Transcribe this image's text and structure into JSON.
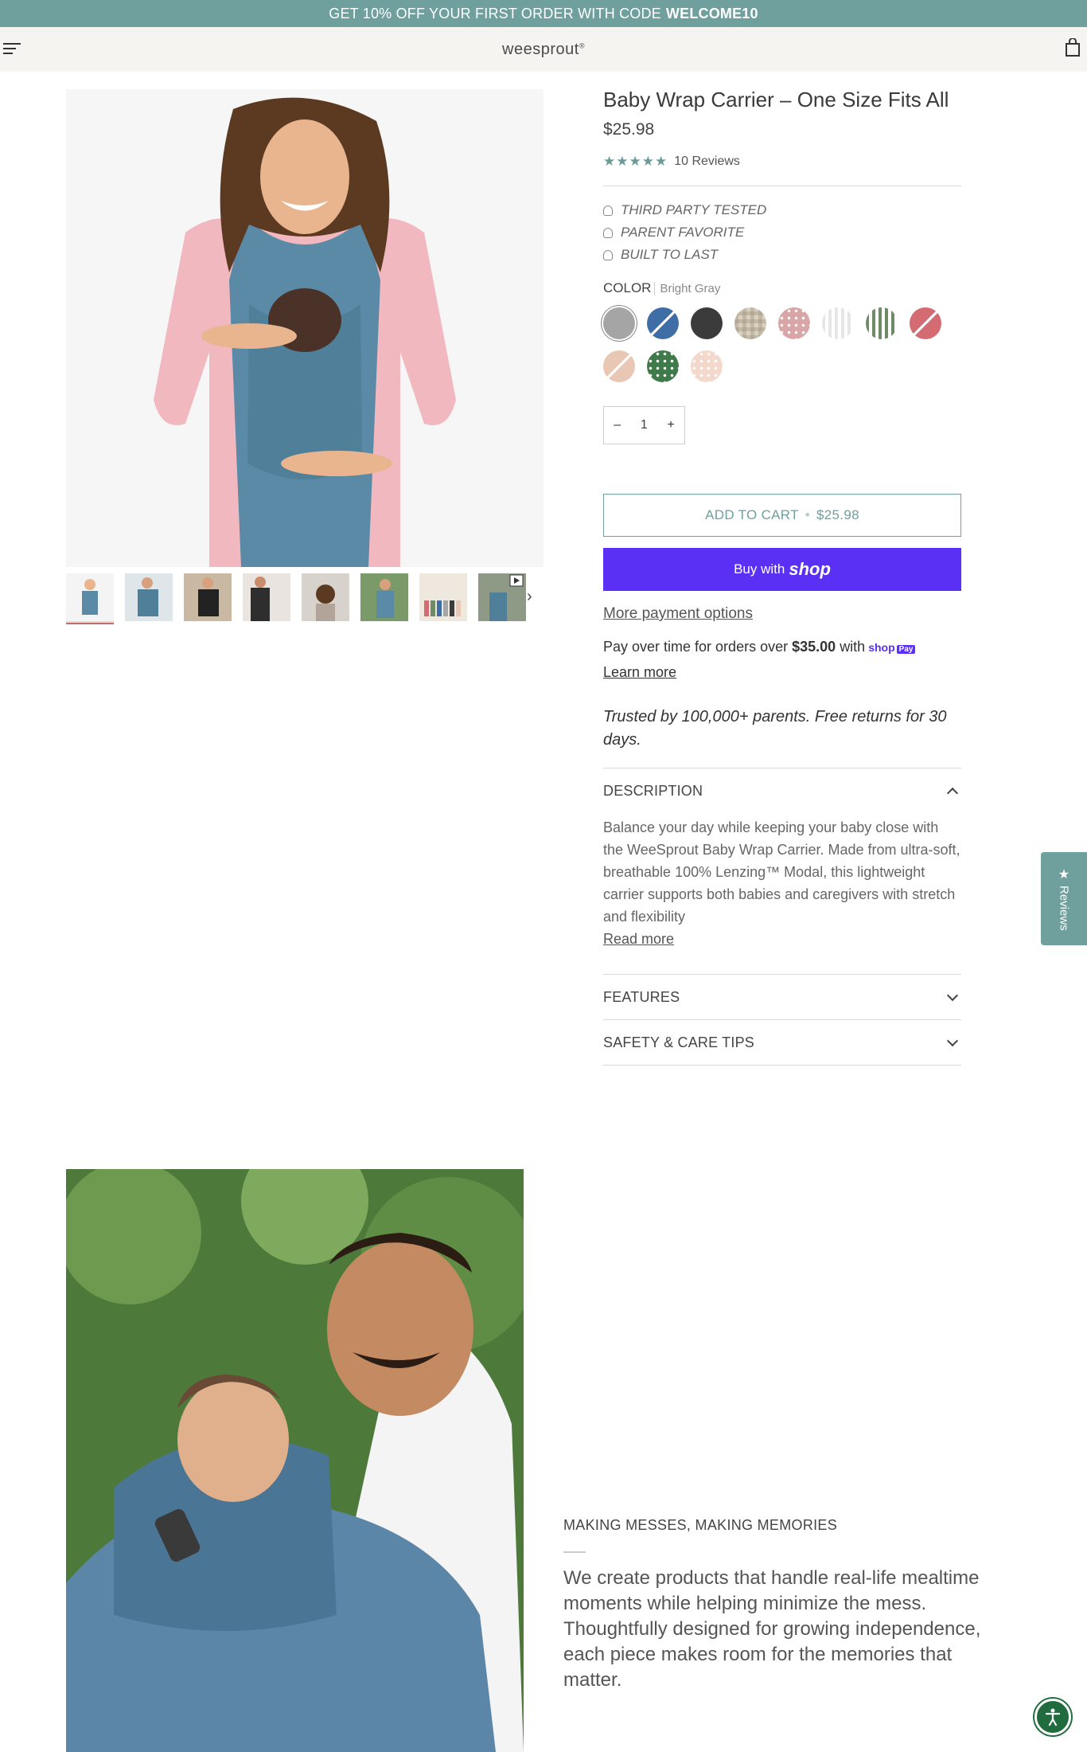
{
  "promo": {
    "text": "GET 10% OFF YOUR FIRST ORDER WITH CODE",
    "code": "WELCOME10"
  },
  "header": {
    "logo": "weesprout"
  },
  "product": {
    "title": "Baby Wrap Carrier – One Size Fits All",
    "price": "$25.98",
    "reviews_label": "10 Reviews",
    "rating": 5,
    "badges": [
      "THIRD PARTY TESTED",
      "PARENT FAVORITE",
      "BUILT TO LAST"
    ],
    "color_label": "COLOR",
    "color_selected": "Bright Gray",
    "swatch_colors": [
      "#a5a5a5",
      "#3f6ea6",
      "#3b3b3b",
      "#d9d0bd",
      "#d9a5a6",
      "#e6e6e6",
      "#6f8a66",
      "#d46b72",
      "#e8c7b4",
      "#3f7a4a",
      "#f4d8cb"
    ],
    "quantity": "1",
    "qty_minus": "–",
    "qty_plus": "+",
    "add_to_cart": "ADD TO CART",
    "add_to_cart_price": "$25.98",
    "buy_with": "Buy with",
    "shop_word": "shop",
    "more_payment": "More payment options",
    "pay_over_prefix": "Pay over time for orders over",
    "pay_over_amount": "$35.00",
    "pay_over_with": "with",
    "shop_pay_logo": "shop",
    "shop_pay_badge": "Pay",
    "learn_more": "Learn more",
    "trusted": "Trusted by 100,000+ parents. Free returns for 30 days."
  },
  "accordion": {
    "description_title": "DESCRIPTION",
    "description_body": "Balance your day while keeping your baby close with the WeeSprout Baby Wrap Carrier. Made from ultra-soft, breathable 100% Lenzing™ Modal, this lightweight carrier supports both babies and caregivers with stretch and flexibility",
    "read_more": "Read more",
    "features_title": "FEATURES",
    "safety_title": "SAFETY & CARE TIPS"
  },
  "reviews_tab": {
    "label": "Reviews"
  },
  "story": {
    "heading": "MAKING MESSES, MAKING MEMORIES",
    "text": "We create products that handle real-life mealtime moments while helping minimize the mess. Thoughtfully designed for growing independence, each piece makes room for the memories that matter."
  }
}
